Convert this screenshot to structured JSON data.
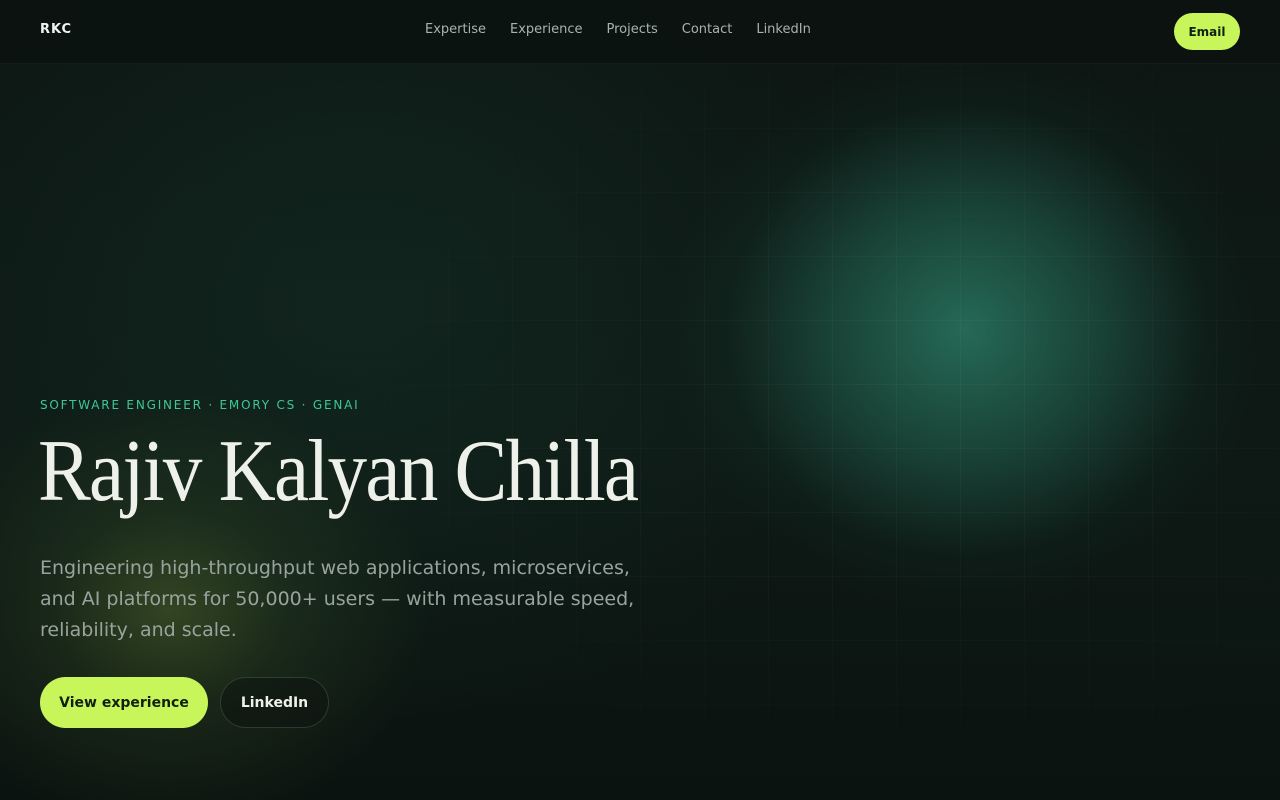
{
  "nav": {
    "logo": "RKC",
    "links": [
      {
        "label": "Expertise"
      },
      {
        "label": "Experience"
      },
      {
        "label": "Projects"
      },
      {
        "label": "Contact"
      },
      {
        "label": "LinkedIn"
      }
    ],
    "email_label": "Email"
  },
  "hero": {
    "eyebrow": "SOFTWARE ENGINEER · EMORY CS · GENAI",
    "name": "Rajiv Kalyan Chilla",
    "description": "Engineering high-throughput web applications, microservices, and AI platforms for 50,000+ users — with measurable speed, reliability, and scale.",
    "primary_cta": "View experience",
    "secondary_cta": "LinkedIn"
  },
  "colors": {
    "accent_lime": "#c8f55a",
    "accent_teal": "#3dc79a",
    "background": "#0c1512"
  }
}
